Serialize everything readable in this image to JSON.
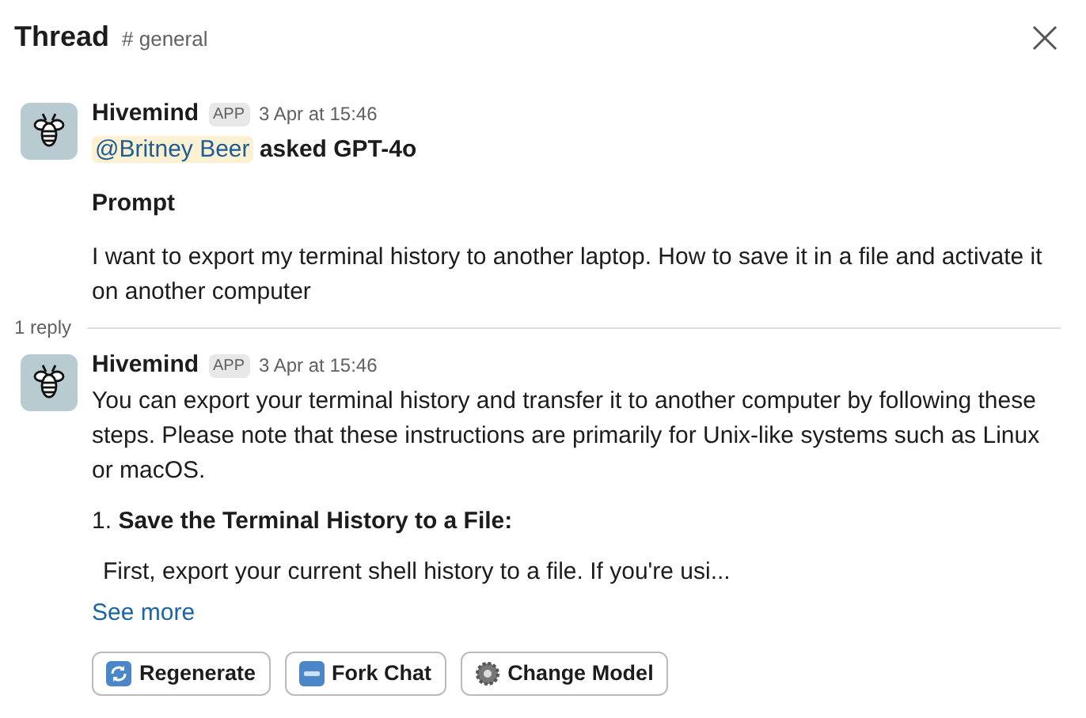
{
  "header": {
    "title": "Thread",
    "channel": "# general"
  },
  "messages": [
    {
      "author": "Hivemind",
      "badge": "APP",
      "time": "3 Apr at 15:46",
      "blocks": [
        {
          "kind": "mention",
          "mention": "@Britney Beer",
          "text": "asked GPT-4o"
        },
        {
          "kind": "heading",
          "text": "Prompt"
        },
        {
          "kind": "paragraph",
          "text": "I want to export my terminal history to another laptop. How to save it in a file and activate it on another computer"
        }
      ]
    },
    {
      "author": "Hivemind",
      "badge": "APP",
      "time": "3 Apr at 15:46",
      "blocks": [
        {
          "kind": "plain",
          "text": "You can export your terminal history and transfer it to another computer by following these steps. Please note that these instructions are primarily for Unix-like systems such as Linux or macOS."
        },
        {
          "kind": "step",
          "text": "1. **Save the Terminal History to a File:**"
        },
        {
          "kind": "indented",
          "text": "First, export your current shell history to a file. If you're usi..."
        },
        {
          "kind": "link",
          "text": "See more"
        },
        {
          "kind": "buttons",
          "buttons": [
            {
              "label": "Regenerate",
              "kind": "refresh"
            },
            {
              "label": "Fork Chat",
              "kind": "new"
            },
            {
              "label": "Change Model",
              "kind": "gear"
            }
          ]
        }
      ]
    }
  ],
  "reply_count": "1 reply"
}
